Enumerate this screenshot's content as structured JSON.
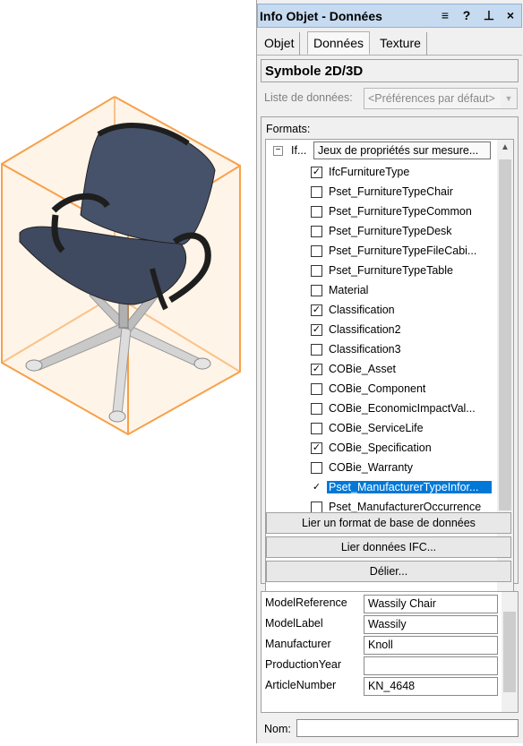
{
  "palette": {
    "title": "Info Objet - Données",
    "buttons": [
      "≡",
      "?",
      "⊥",
      "×"
    ],
    "tabs": [
      {
        "label": "Objet",
        "active": false
      },
      {
        "label": "Données",
        "active": true
      },
      {
        "label": "Texture",
        "active": false
      }
    ],
    "symbol_label": "Symbole 2D/3D",
    "data_list": {
      "label": "Liste de données:",
      "value": "<Préférences par défaut>"
    },
    "formats": {
      "label": "Formats:",
      "root": {
        "short_label": "If...",
        "button": "Jeux de propriétés sur mesure..."
      },
      "items": [
        {
          "label": "IfcFurnitureType",
          "checked": true,
          "selected": false
        },
        {
          "label": "Pset_FurnitureTypeChair",
          "checked": false,
          "selected": false
        },
        {
          "label": "Pset_FurnitureTypeCommon",
          "checked": false,
          "selected": false
        },
        {
          "label": "Pset_FurnitureTypeDesk",
          "checked": false,
          "selected": false
        },
        {
          "label": "Pset_FurnitureTypeFileCabi...",
          "checked": false,
          "selected": false
        },
        {
          "label": "Pset_FurnitureTypeTable",
          "checked": false,
          "selected": false
        },
        {
          "label": "Material",
          "checked": false,
          "selected": false
        },
        {
          "label": "Classification",
          "checked": true,
          "selected": false
        },
        {
          "label": "Classification2",
          "checked": true,
          "selected": false
        },
        {
          "label": "Classification3",
          "checked": false,
          "selected": false
        },
        {
          "label": "COBie_Asset",
          "checked": true,
          "selected": false
        },
        {
          "label": "COBie_Component",
          "checked": false,
          "selected": false
        },
        {
          "label": "COBie_EconomicImpactVal...",
          "checked": false,
          "selected": false
        },
        {
          "label": "COBie_ServiceLife",
          "checked": false,
          "selected": false
        },
        {
          "label": "COBie_Specification",
          "checked": true,
          "selected": false
        },
        {
          "label": "COBie_Warranty",
          "checked": false,
          "selected": false
        },
        {
          "label": "Pset_ManufacturerTypeInfor...",
          "checked": true,
          "selected": true
        },
        {
          "label": "Pset_ManufacturerOccurrence",
          "checked": false,
          "selected": false
        }
      ]
    },
    "buttons_bottom": {
      "link_db": "Lier un format de base de données",
      "link_ifc": "Lier données IFC...",
      "unlink": "Délier..."
    },
    "properties": [
      {
        "key": "ModelReference",
        "value": "Wassily Chair"
      },
      {
        "key": "ModelLabel",
        "value": "Wassily"
      },
      {
        "key": "Manufacturer",
        "value": "Knoll"
      },
      {
        "key": "ProductionYear",
        "value": ""
      },
      {
        "key": "ArticleNumber",
        "value": "KN_4648"
      }
    ],
    "name_field": {
      "label": "Nom:",
      "value": ""
    }
  },
  "colors": {
    "bounding_box": "#f7a04a",
    "seat": "#46526a",
    "selection": "#0078d7"
  }
}
